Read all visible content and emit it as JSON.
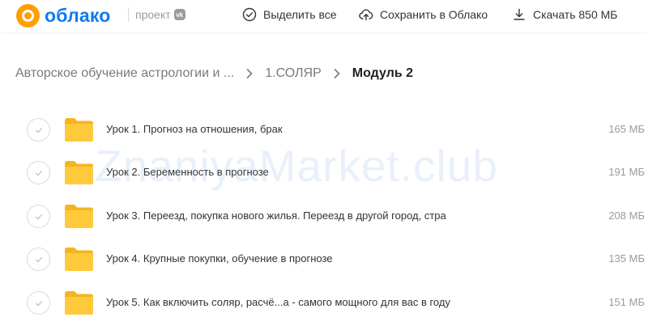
{
  "header": {
    "logo_text": "облако",
    "project_label": "проект",
    "vk_badge": "vk",
    "actions": {
      "select_all": "Выделить все",
      "save_to_cloud": "Сохранить в Облако",
      "download": "Скачать 850 МБ"
    }
  },
  "breadcrumb": {
    "items": [
      "Авторское обучение астрологии и ...",
      "1.СОЛЯР"
    ],
    "current": "Модуль 2"
  },
  "files": [
    {
      "name": "Урок 1. Прогноз на отношения, брак",
      "size": "165 МБ"
    },
    {
      "name": "Урок 2. Беременность в прогнозе",
      "size": "191 МБ"
    },
    {
      "name": "Урок 3. Переезд, покупка нового жилья. Переезд в другой город, стра",
      "size": "208 МБ"
    },
    {
      "name": "Урок 4. Крупные покупки, обучение в прогнозе",
      "size": "135 МБ"
    },
    {
      "name": "Урок 5. Как включить соляр, расчё...а - самого мощного для вас в году",
      "size": "151 МБ"
    }
  ],
  "watermark": "ZnaniyaMarket.club",
  "colors": {
    "brand_blue": "#0d7cf2",
    "brand_orange": "#ff9e00",
    "folder_yellow": "#ffc93c"
  },
  "icons": {
    "select_all": "check-circle-icon",
    "save": "cloud-upload-icon",
    "download": "download-icon",
    "folder": "folder-icon",
    "breadcrumb_separator": "chevron-right-icon"
  }
}
